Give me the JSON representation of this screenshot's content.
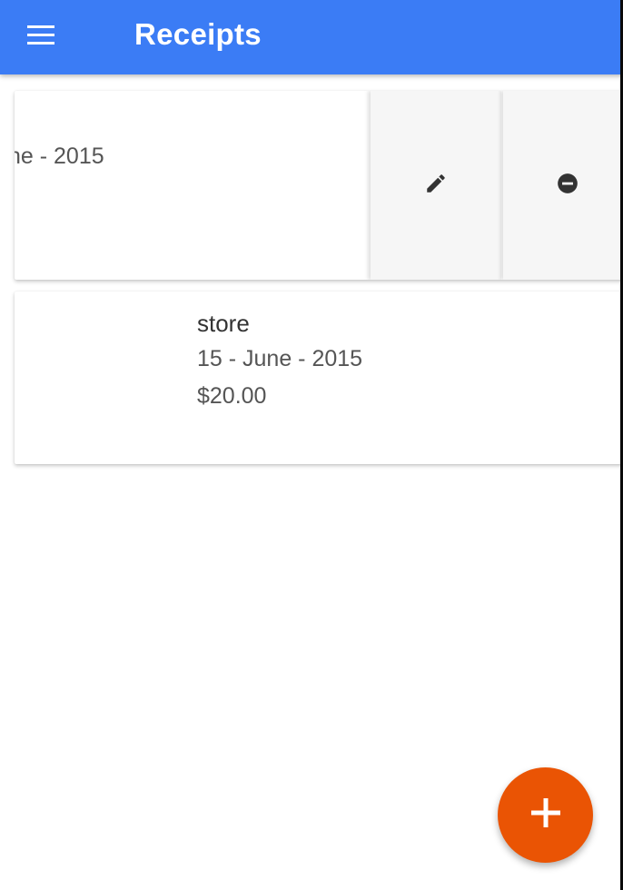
{
  "app_bar": {
    "title": "Receipts",
    "menu_icon": "hamburger-menu-icon",
    "background_color": "#3b7cf5"
  },
  "receipts": [
    {
      "date_visible_fragment": "ne - 2015",
      "actions": [
        {
          "name": "edit",
          "icon": "pencil-icon"
        },
        {
          "name": "delete",
          "icon": "remove-circle-icon"
        }
      ]
    },
    {
      "store": "store",
      "date": "15 - June - 2015",
      "amount": "$20.00"
    }
  ],
  "fab": {
    "icon": "plus-icon",
    "color": "#ea5404"
  }
}
